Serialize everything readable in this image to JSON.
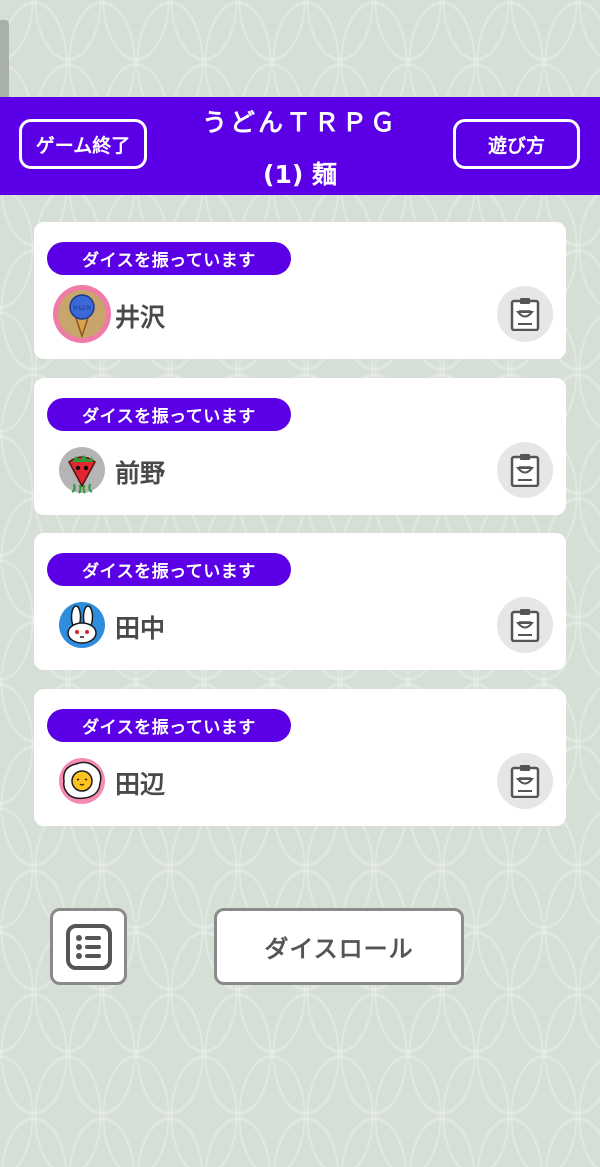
{
  "header": {
    "title": "うどんＴＲＰＧ",
    "subtitle": "(1) 麺",
    "end_button": "ゲーム終了",
    "howto_button": "遊び方",
    "color": "#5b00e6"
  },
  "players": [
    {
      "status": "ダイスを振っています",
      "name": "井沢",
      "avatar": "ice-cream-icon",
      "sheet_icon": "clipboard-icon"
    },
    {
      "status": "ダイスを振っています",
      "name": "前野",
      "avatar": "strawberry-icon",
      "sheet_icon": "clipboard-icon"
    },
    {
      "status": "ダイスを振っています",
      "name": "田中",
      "avatar": "rabbit-icon",
      "sheet_icon": "clipboard-icon"
    },
    {
      "status": "ダイスを振っています",
      "name": "田辺",
      "avatar": "fried-egg-icon",
      "sheet_icon": "clipboard-icon"
    }
  ],
  "footer": {
    "list_icon": "list-icon",
    "dice_roll_button": "ダイスロール"
  }
}
